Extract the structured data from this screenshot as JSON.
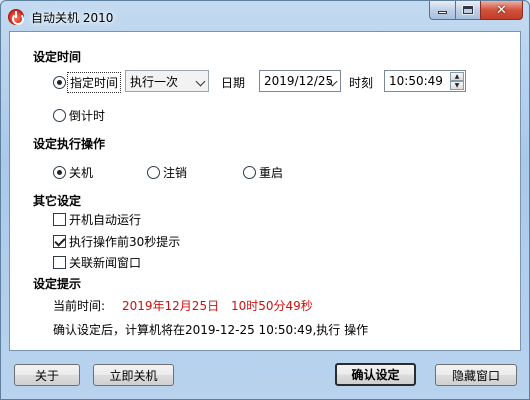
{
  "window": {
    "title": "自动关机 2010"
  },
  "title_buttons": {
    "minimize": "—",
    "maximize": "□",
    "close": "✕"
  },
  "set_time": {
    "heading": "设定时间",
    "specified_time_label": "指定时间",
    "specified_time_checked": true,
    "repeat_select": "执行一次",
    "date_label": "日期",
    "date_value": "2019/12/25",
    "time_label": "时刻",
    "time_value": "10:50:49",
    "countdown_label": "倒计时",
    "countdown_checked": false
  },
  "action": {
    "heading": "设定执行操作",
    "options": [
      {
        "label": "关机",
        "checked": true
      },
      {
        "label": "注销",
        "checked": false
      },
      {
        "label": "重启",
        "checked": false
      }
    ]
  },
  "other": {
    "heading": "其它设定",
    "options": [
      {
        "label": "开机自动运行",
        "checked": false
      },
      {
        "label": "执行操作前30秒提示",
        "checked": true
      },
      {
        "label": "关联新闻窗口",
        "checked": false
      }
    ]
  },
  "hint": {
    "heading": "设定提示",
    "current_label": "当前时间:",
    "current_date": "2019年12月25日",
    "current_time": "10时50分49秒",
    "confirm_text": "确认设定后，计算机将在2019-12-25 10:50:49,执行  操作"
  },
  "buttons": {
    "about": "关于",
    "shutdown_now": "立即关机",
    "confirm": "确认设定",
    "hide": "隐藏窗口"
  },
  "colors": {
    "accent_red": "#d01010",
    "title_bar": "#a9c9ea"
  }
}
